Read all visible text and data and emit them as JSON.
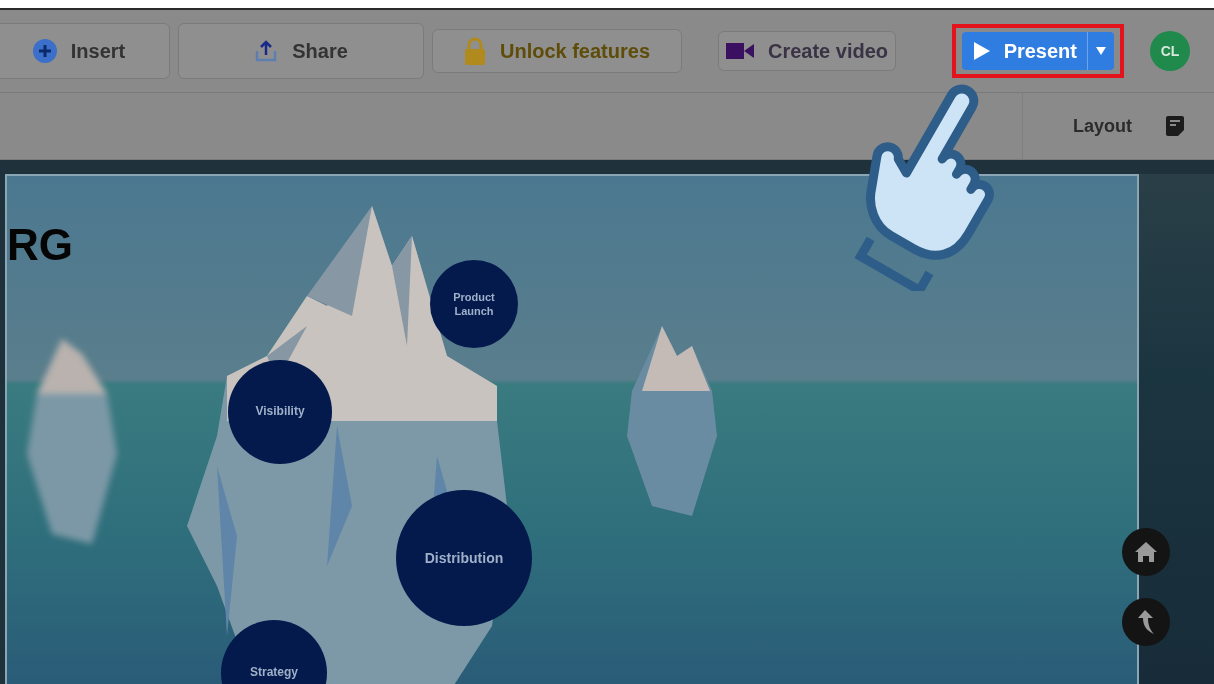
{
  "toolbar": {
    "buttons": [
      {
        "kind": "insert",
        "label": "Insert"
      },
      {
        "kind": "share",
        "label": "Share"
      },
      {
        "kind": "unlock",
        "label": "Unlock features"
      },
      {
        "kind": "video",
        "label": "Create video"
      }
    ],
    "present": {
      "label": "Present",
      "highlighted": true
    },
    "avatar": {
      "initials": "CL"
    }
  },
  "subbar": {
    "layout_label": "Layout"
  },
  "slide": {
    "title": "RG",
    "topics": [
      {
        "label": "Product Launch"
      },
      {
        "label": "Visibility"
      },
      {
        "label": "Distribution"
      },
      {
        "label": "Strategy"
      }
    ]
  }
}
